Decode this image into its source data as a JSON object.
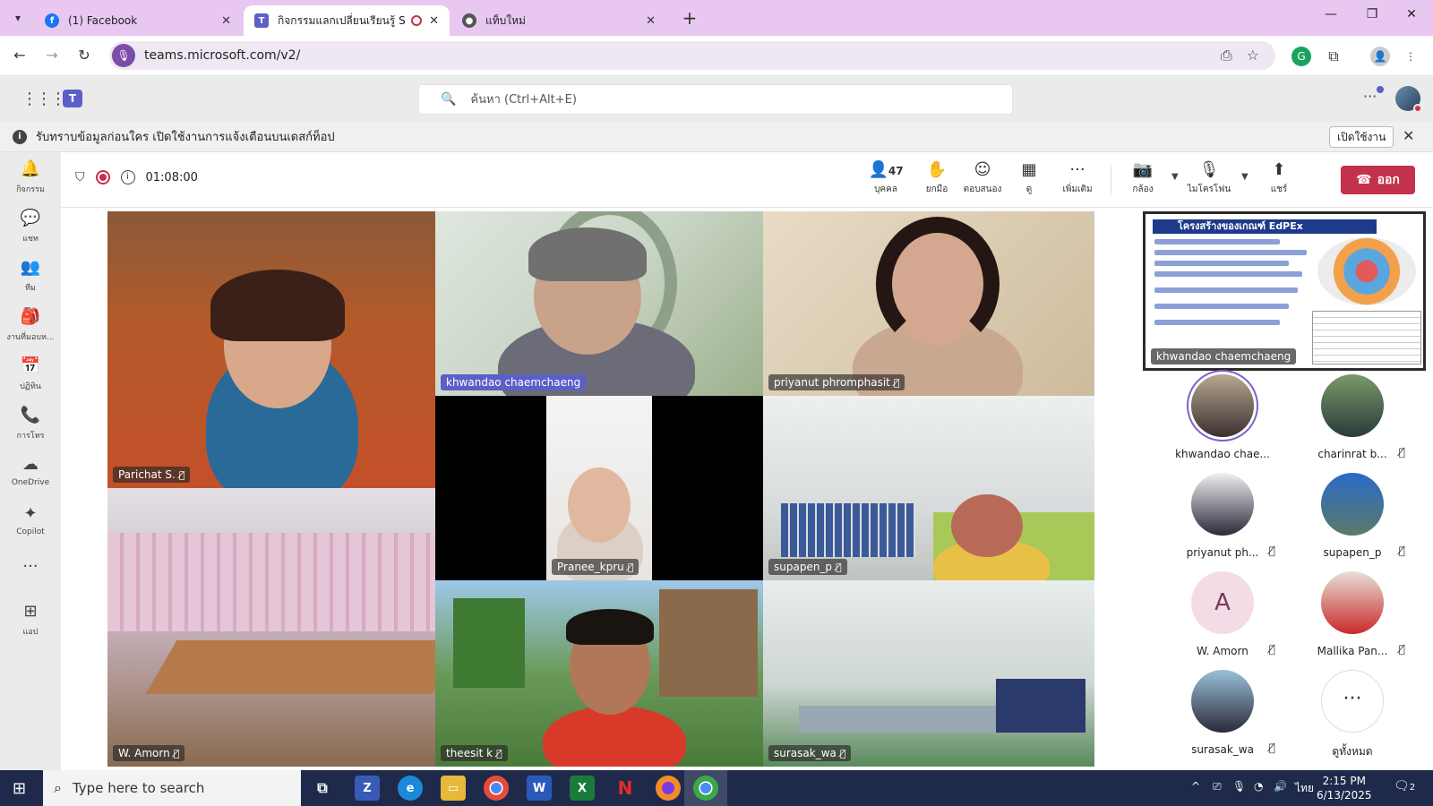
{
  "browser": {
    "tabs": [
      {
        "title": "(1) Facebook",
        "icon": "facebook-icon",
        "color": "#1877f2"
      },
      {
        "title": "กิจกรรมแลกเปลี่ยนเรียนรู้ SAR -",
        "icon": "teams-icon",
        "color": "#5b5fc7"
      },
      {
        "title": "แท็บใหม่",
        "icon": "chrome-icon",
        "color": "#444444"
      }
    ],
    "url": "teams.microsoft.com/v2/"
  },
  "teams": {
    "search_placeholder": "ค้นหา (Ctrl+Alt+E)",
    "banner_text": "รับทราบข้อมูลก่อนใคร เปิดใช้งานการแจ้งเตือนบนเดสก์ท็อป",
    "banner_button": "เปิดใช้งาน",
    "rail": [
      {
        "label": "กิจกรรม",
        "icon": "bell-icon"
      },
      {
        "label": "แชท",
        "icon": "chat-icon"
      },
      {
        "label": "ทีม",
        "icon": "teams-group-icon"
      },
      {
        "label": "งานที่มอบห...",
        "icon": "assignments-icon"
      },
      {
        "label": "ปฏิทิน",
        "icon": "calendar-icon"
      },
      {
        "label": "การโทร",
        "icon": "phone-icon"
      },
      {
        "label": "OneDrive",
        "icon": "cloud-icon"
      },
      {
        "label": "Copilot",
        "icon": "copilot-icon"
      },
      {
        "label": "แอป",
        "icon": "add-app-icon"
      }
    ]
  },
  "meeting": {
    "elapsed": "01:08:00",
    "people_count": "47",
    "buttons": {
      "people": "บุคคล",
      "raise_hand": "ยกมือ",
      "react": "ตอบสนอง",
      "view": "ดู",
      "more": "เพิ่มเติม",
      "camera": "กล้อง",
      "mic": "ไมโครโฟน",
      "share": "แชร์",
      "leave": "ออก"
    },
    "tiles": [
      {
        "name": "Parichat S.",
        "muted": true
      },
      {
        "name": "khwandao chaemchaeng",
        "muted": false
      },
      {
        "name": "priyanut phromphasit",
        "muted": true
      },
      {
        "name": "Pranee_kpru",
        "muted": true
      },
      {
        "name": "supapen_p",
        "muted": true
      },
      {
        "name": "W. Amorn",
        "muted": true
      },
      {
        "name": "theesit k",
        "muted": true
      },
      {
        "name": "surasak_wa",
        "muted": true
      }
    ],
    "shared_content": {
      "presenter": "khwandao chaemchaeng",
      "slide_title": "โครงสร้างของเกณฑ์ EdPEx"
    },
    "roster": [
      {
        "name": "khwandao chae...",
        "muted": false,
        "active": true
      },
      {
        "name": "charinrat b...",
        "muted": true
      },
      {
        "name": "priyanut ph...",
        "muted": true
      },
      {
        "name": "supapen_p",
        "muted": true
      },
      {
        "name": "W. Amorn",
        "muted": true,
        "initial": "A"
      },
      {
        "name": "Mallika Pan...",
        "muted": true
      },
      {
        "name": "surasak_wa",
        "muted": true
      },
      {
        "name": "ดูทั้งหมด",
        "muted": false
      }
    ]
  },
  "taskbar": {
    "search_text": "Type here to search",
    "time": "2:15 PM",
    "date": "6/13/2025",
    "lang": "ไทย",
    "notif_count": "2"
  }
}
